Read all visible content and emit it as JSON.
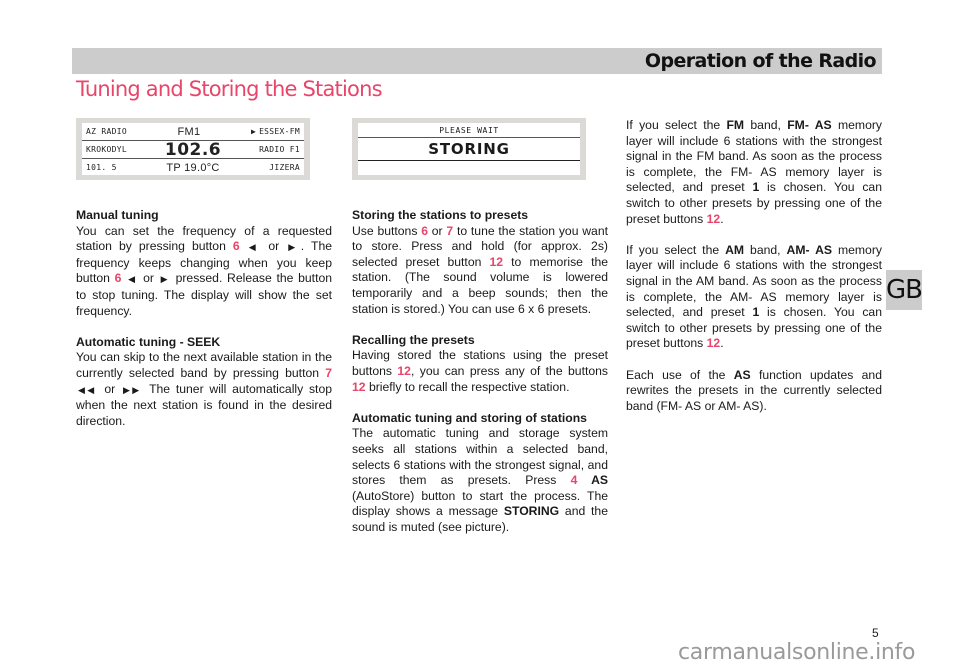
{
  "header": {
    "section_title": "Operation of the Radio"
  },
  "page_title": "Tuning and Storing the Stations",
  "display_radio": {
    "row1": {
      "left": "AZ RADIO",
      "center": "FM1",
      "right_icon": "play-triangle-icon",
      "right": "ESSEX-FM"
    },
    "row2": {
      "left": "KROKODYL",
      "center": "102.6",
      "right": "RADIO F1"
    },
    "row3": {
      "left": "101. 5",
      "center": "TP 19.0°C",
      "right": "JIZERA"
    }
  },
  "display_storing": {
    "top": "PLEASE WAIT",
    "main": "STORING"
  },
  "column1": {
    "manual": {
      "heading": "Manual tuning",
      "t1": "You can set the frequency of a requested station by pressing button ",
      "btn1": "6",
      "left_icon": "◀",
      "or1": " or ",
      "right_icon": "▶",
      "t2": ". The frequency keeps changing when you keep button ",
      "btn2": "6",
      "or2": " or ",
      "t3": " pressed. Release the button to stop tuning. The display will show the set frequency."
    },
    "seek": {
      "heading": "Automatic tuning - SEEK",
      "t1": "You can skip to the next available station in the currently selected band by pressing button ",
      "btn": "7",
      "rewind_icon": "◀◀",
      "or": " or ",
      "ff_icon": "▶▶",
      "t2": " The tuner will automatically stop when the next station is found in the desired direction."
    }
  },
  "column2": {
    "storing": {
      "heading": "Storing the stations to presets",
      "t1": "Use buttons ",
      "btn6": "6",
      "or": " or ",
      "btn7": "7",
      "t2": " to tune the station you want to store. Press and hold (for approx. 2s) selected preset button ",
      "btn12": "12",
      "t3": " to memorise the station. (The sound volume is lowered temporarily and a beep sounds; then the station is stored.) You can use 6 x 6 presets."
    },
    "recalling": {
      "heading": "Recalling the presets",
      "t1": "Having stored the stations using the preset buttons ",
      "btn_a": "12",
      "t2": ", you can press any of the buttons ",
      "btn_b": "12",
      "t3": " briefly to recall the respective station."
    },
    "auto": {
      "heading": "Automatic tuning and storing of stations",
      "t1": "The automatic tuning and storage system seeks all stations within a selected band, selects 6 stations with the strongest signal, and stores them as presets. Press ",
      "btn4": "4",
      "as": " AS",
      "t2": " (AutoStore) button to start the process. The display shows a message ",
      "storing": "STORING",
      "t3": " and the sound is muted (see picture)."
    }
  },
  "column3": {
    "fm": {
      "t1": "If you select the ",
      "band": "FM",
      "t2": " band, ",
      "layer": "FM- AS",
      "t3": " memory layer will include 6 stations with the strongest signal in the FM band. As soon as the process is complete, the FM- AS memory layer is selected, and preset ",
      "preset": "1",
      "t4": " is chosen. You can switch to other presets by pressing one of the preset buttons ",
      "btn": "12",
      "t5": "."
    },
    "am": {
      "t1": "If you select the ",
      "band": "AM",
      "t2": " band, ",
      "layer": "AM- AS",
      "t3": " memory layer will include 6 stations with the strongest signal in the AM band. As soon as the process is complete, the AM- AS memory layer is selected, and preset ",
      "preset": "1",
      "t4": " is chosen. You can switch to other presets by pressing one of the preset buttons ",
      "btn": "12",
      "t5": "."
    },
    "as": {
      "t1": "Each use of the ",
      "as": "AS",
      "t2": " function updates and rewrites the presets in the currently selected band (FM- AS or AM- AS)."
    }
  },
  "language_tab": "GB",
  "page_number": "5",
  "watermark": "carmanualsonline.info",
  "colors": {
    "accent": "#e8456a",
    "header_bg": "#cccccc"
  }
}
